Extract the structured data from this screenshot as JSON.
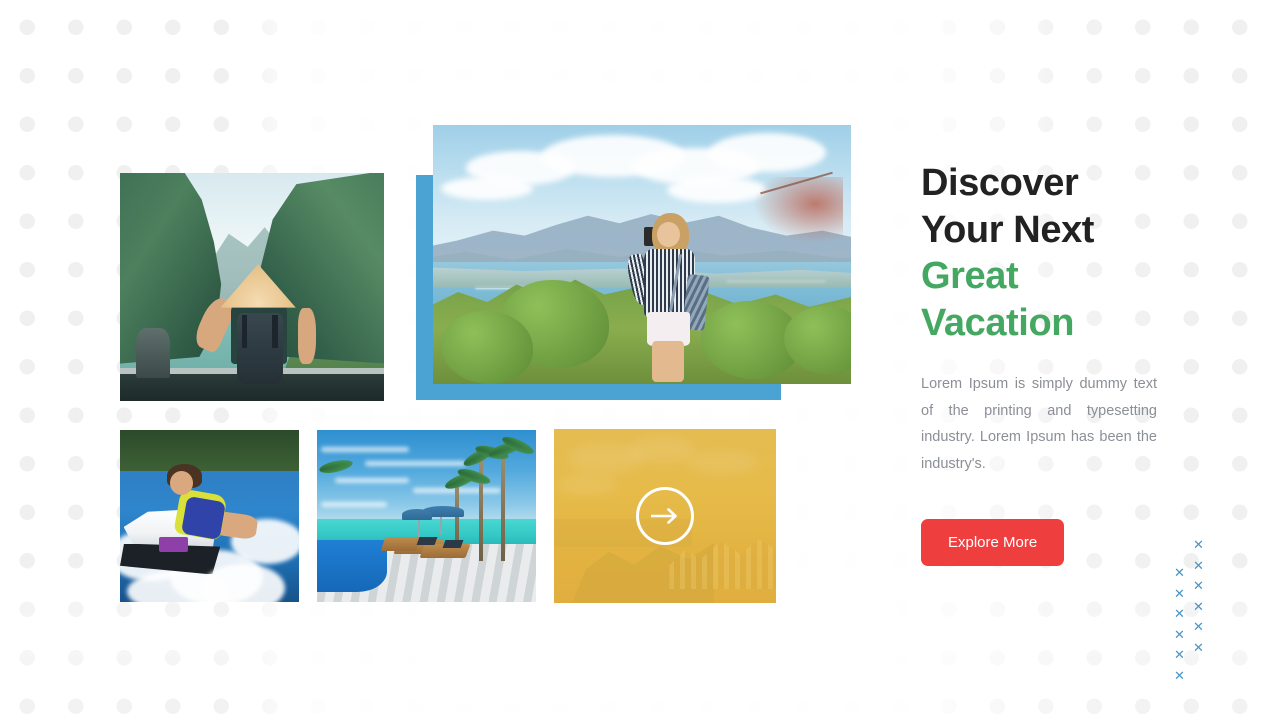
{
  "theme": {
    "accent_green": "#45a862",
    "accent_blue": "#4ba3d3",
    "cta_red": "#ef3e3e",
    "overlay_yellow": "#e6b845",
    "heading_dark": "#222222",
    "body_gray": "#8b8f96",
    "dot_gray": "#f0f0f0"
  },
  "content": {
    "headline_line1": "Discover",
    "headline_line2": "Your Next",
    "headline_accent_line1": "Great",
    "headline_accent_line2": "Vacation",
    "paragraph": "Lorem Ipsum is simply dummy text of the printing and typesetting industry. Lorem Ipsum has been the industry's.",
    "cta_label": "Explore More"
  },
  "gallery": {
    "hero": {
      "alt": "Woman photographing a tropical coastline from a hilltop"
    },
    "left": {
      "alt": "Traveler in a conical hat overlooking a river valley"
    },
    "thumbs": [
      {
        "alt": "Jet ski rider racing across blue water"
      },
      {
        "alt": "Beach resort pool with loungers and palm trees"
      },
      {
        "alt": "Coastal cliff town under a yellow overlay"
      }
    ],
    "arrow_icon": "arrow-right-icon"
  },
  "decor": {
    "dot_pattern": "background-dot-grid",
    "x_pattern": "x-mark-cluster",
    "x_glyph": "✕",
    "x_column_a": [
      0,
      1,
      2,
      3,
      4,
      5
    ],
    "x_column_b": [
      0,
      1,
      2,
      3,
      4,
      5
    ]
  }
}
